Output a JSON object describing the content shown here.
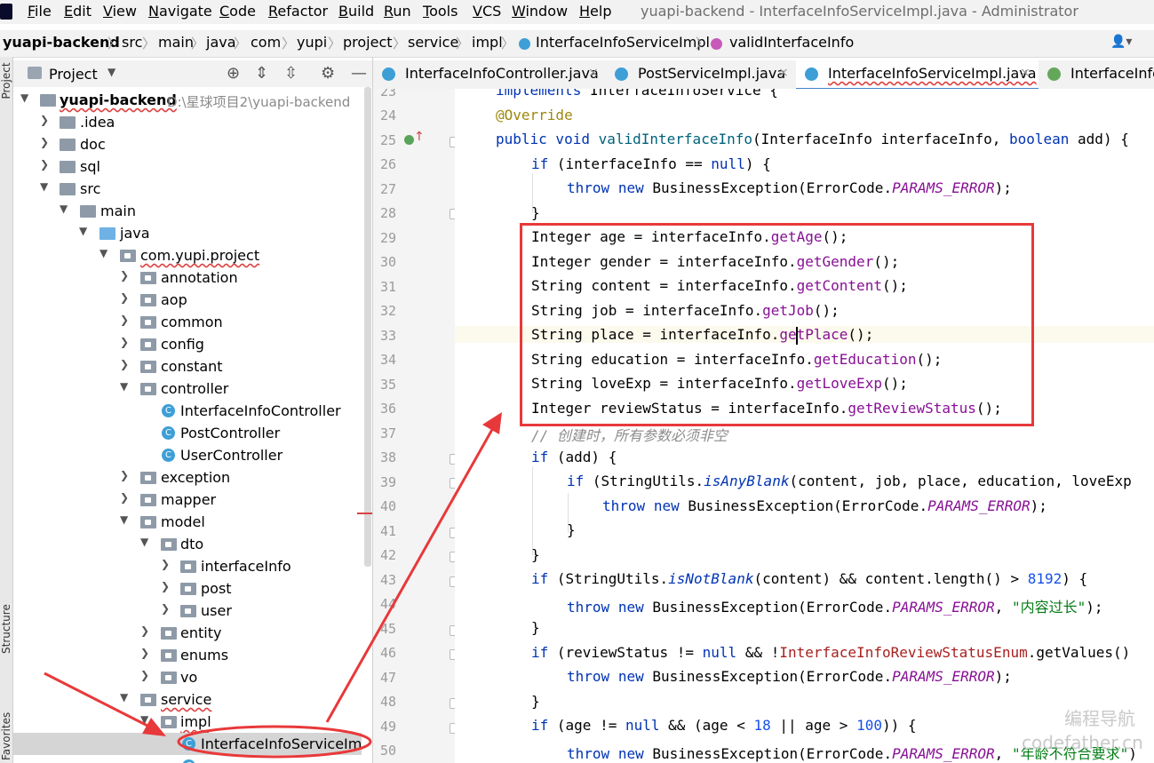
{
  "window": {
    "title": "yuapi-backend - InterfaceInfoServiceImpl.java - Administrator"
  },
  "menu": [
    "File",
    "Edit",
    "View",
    "Navigate",
    "Code",
    "Refactor",
    "Build",
    "Run",
    "Tools",
    "VCS",
    "Window",
    "Help"
  ],
  "breadcrumb": [
    "yuapi-backend",
    "src",
    "main",
    "java",
    "com",
    "yupi",
    "project",
    "service",
    "impl",
    "InterfaceInfoServiceImpl",
    "validInterfaceInfo"
  ],
  "side_strip": {
    "project": "Project",
    "structure": "Structure",
    "favorites": "Favorites"
  },
  "project_panel": {
    "title": "Project"
  },
  "tree": [
    {
      "label": "yuapi-backend",
      "path": "D:\\星球项目2\\yuapi-backend"
    },
    {
      "label": ".idea"
    },
    {
      "label": "doc"
    },
    {
      "label": "sql"
    },
    {
      "label": "src"
    },
    {
      "label": "main"
    },
    {
      "label": "java"
    },
    {
      "label": "com.yupi.project"
    },
    {
      "label": "annotation"
    },
    {
      "label": "aop"
    },
    {
      "label": "common"
    },
    {
      "label": "config"
    },
    {
      "label": "constant"
    },
    {
      "label": "controller"
    },
    {
      "label": "InterfaceInfoController"
    },
    {
      "label": "PostController"
    },
    {
      "label": "UserController"
    },
    {
      "label": "exception"
    },
    {
      "label": "mapper"
    },
    {
      "label": "model"
    },
    {
      "label": "dto"
    },
    {
      "label": "interfaceInfo"
    },
    {
      "label": "post"
    },
    {
      "label": "user"
    },
    {
      "label": "entity"
    },
    {
      "label": "enums"
    },
    {
      "label": "vo"
    },
    {
      "label": "service"
    },
    {
      "label": "impl"
    },
    {
      "label": "InterfaceInfoServiceImpl"
    }
  ],
  "tabs": [
    {
      "label": "InterfaceInfoController.java"
    },
    {
      "label": "PostServiceImpl.java"
    },
    {
      "label": "InterfaceInfoServiceImpl.java"
    },
    {
      "label": "InterfaceInfoS"
    }
  ],
  "line_numbers": [
    "23",
    "24",
    "25",
    "26",
    "27",
    "28",
    "29",
    "30",
    "31",
    "32",
    "33",
    "34",
    "35",
    "36",
    "37",
    "38",
    "39",
    "40",
    "41",
    "42",
    "43",
    "44",
    "45",
    "46",
    "47",
    "48",
    "49",
    "50"
  ],
  "code": {
    "l23a": "implements",
    "l23b": " InterfaceInfoService {",
    "l24": "@Override",
    "l25_kw1": "public",
    "l25_kw2": " void ",
    "l25_fn": "validInterfaceInfo",
    "l25_rest1": "(InterfaceInfo interfaceInfo, ",
    "l25_kw3": "boolean",
    "l25_rest2": " add) {",
    "l26_kw": "if",
    "l26_a": " (interfaceInfo == ",
    "l26_null": "null",
    "l26_b": ") {",
    "l27_kw1": "throw",
    "l27_sp": " ",
    "l27_kw2": "new",
    "l27_a": " BusinessException(ErrorCode.",
    "l27_c": "PARAMS_ERROR",
    "l27_b": ");",
    "l28": "}",
    "l29_a": "Integer age = interfaceInfo.",
    "l29_m": "getAge",
    "l29_b": "();",
    "l30_a": "Integer gender = interfaceInfo.",
    "l30_m": "getGender",
    "l30_b": "();",
    "l31_a": "String content = interfaceInfo.",
    "l31_m": "getContent",
    "l31_b": "();",
    "l32_a": "String job = interfaceInfo.",
    "l32_m": "getJob",
    "l32_b": "();",
    "l33_a": "String place = interfaceInfo.",
    "l33_m": "getPlace",
    "l33_b": "();",
    "l34_a": "String education = interfaceInfo.",
    "l34_m": "getEducation",
    "l34_b": "();",
    "l35_a": "String loveExp = interfaceInfo.",
    "l35_m": "getLoveExp",
    "l35_b": "();",
    "l36_a": "Integer reviewStatus = interfaceInfo.",
    "l36_m": "getReviewStatus",
    "l36_b": "();",
    "l37": "// 创建时，所有参数必须非空",
    "l38_kw": "if",
    "l38_a": " (add) {",
    "l39_kw": "if",
    "l39_a": " (StringUtils.",
    "l39_m": "isAnyBlank",
    "l39_b": "(content, job, place, education, loveExp",
    "l40_kw1": "throw",
    "l40_kw2": "new",
    "l40_a": " BusinessException(ErrorCode.",
    "l40_c": "PARAMS_ERROR",
    "l40_b": ");",
    "l41": "}",
    "l42": "}",
    "l43_kw": "if",
    "l43_a": " (StringUtils.",
    "l43_m": "isNotBlank",
    "l43_b": "(content) && content.length() > ",
    "l43_n": "8192",
    "l43_c": ") {",
    "l44_kw1": "throw",
    "l44_kw2": "new",
    "l44_a": " BusinessException(ErrorCode.",
    "l44_c": "PARAMS_ERROR",
    "l44_b": ", ",
    "l44_s": "\"内容过长\"",
    "l44_e": ");",
    "l45": "}",
    "l46_kw": "if",
    "l46_a": " (reviewStatus != ",
    "l46_null": "null",
    "l46_b": " && !",
    "l46_e": "InterfaceInfoReviewStatusEnum",
    "l46_c": ".getValues()",
    "l47_kw1": "throw",
    "l47_kw2": "new",
    "l47_a": " BusinessException(ErrorCode.",
    "l47_c": "PARAMS_ERROR",
    "l47_b": ");",
    "l48": "}",
    "l49_kw": "if",
    "l49_a": " (age != ",
    "l49_null": "null",
    "l49_b": " && (age < ",
    "l49_n1": "18",
    "l49_c": " || age > ",
    "l49_n2": "100",
    "l49_d": ")) {",
    "l50_kw1": "throw",
    "l50_kw2": "new",
    "l50_a": " BusinessException(ErrorCode.",
    "l50_c": "PARAMS_ERROR",
    "l50_b": ", ",
    "l50_s": "\"年龄不符合要求\"",
    "l50_e": ")"
  },
  "watermark": {
    "line1": "编程导航",
    "line2": "codefather.cn"
  },
  "colors": {
    "annotation_red": "#e8393a",
    "keyword": "#0033b3",
    "method_call": "#871094",
    "string": "#067d17"
  }
}
